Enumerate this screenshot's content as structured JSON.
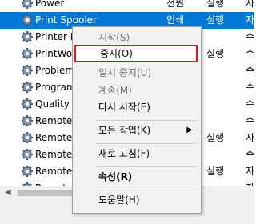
{
  "services": [
    {
      "name": "Power",
      "startup": "전원",
      "status": "실행",
      "type": "자"
    },
    {
      "name": "Print Spooler",
      "startup": "인쇄",
      "status": "실행",
      "type": "자",
      "selected": true
    },
    {
      "name": "Printer E",
      "startup": "",
      "status": "",
      "type": "수"
    },
    {
      "name": "PrintWor",
      "startup": "",
      "status": "실행",
      "type": "수"
    },
    {
      "name": "Problem",
      "startup": "",
      "status": "",
      "type": "수"
    },
    {
      "name": "Program",
      "startup": "",
      "status": "",
      "type": "수"
    },
    {
      "name": "Quality V",
      "startup": "",
      "status": "",
      "type": "수"
    },
    {
      "name": "Remote",
      "startup": "",
      "status": "",
      "type": "수"
    },
    {
      "name": "Remote",
      "startup": "",
      "status": "실행",
      "type": "자"
    },
    {
      "name": "Remote",
      "startup": "",
      "status": "",
      "type": "수"
    },
    {
      "name": "Remote",
      "startup": "",
      "status": "실행",
      "type": "자"
    },
    {
      "name": "Remote",
      "startup": "",
      "status": "",
      "type": "자"
    }
  ],
  "context_menu": {
    "start": "시작(S)",
    "stop": "중지(O)",
    "pause": "일시 중지(U)",
    "resume": "계속(M)",
    "restart": "다시 시작(E)",
    "all_tasks": "모든 작업(K)",
    "refresh": "새로 고침(F)",
    "properties": "속성(R)",
    "help": "도움말(H)"
  },
  "colors": {
    "selection": "#0078d7",
    "highlight_border": "#e81123"
  }
}
